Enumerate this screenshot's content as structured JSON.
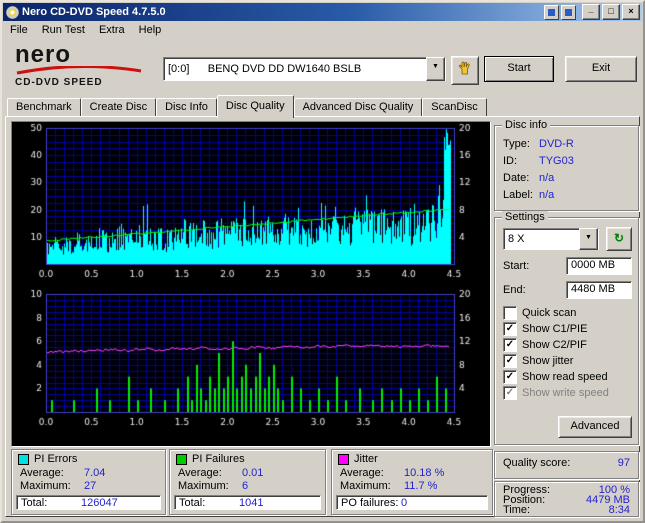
{
  "window": {
    "title": "Nero CD-DVD Speed 4.7.5.0"
  },
  "icons": {
    "minimize": "_",
    "maximize": "□",
    "close": "×",
    "dropdown": "▼",
    "refresh": "↻",
    "check": "✓"
  },
  "menu": {
    "items": [
      {
        "label": "File"
      },
      {
        "label": "Run Test"
      },
      {
        "label": "Extra"
      },
      {
        "label": "Help"
      }
    ]
  },
  "toolbar": {
    "logo_line1": "nero",
    "logo_line2": "CD-DVD SPEED",
    "drive_combo": "[0:0]      BENQ DVD DD DW1640 BSLB",
    "start_label": "Start",
    "exit_label": "Exit"
  },
  "tabs": {
    "items": [
      {
        "label": "Benchmark",
        "active": false
      },
      {
        "label": "Create Disc",
        "active": false
      },
      {
        "label": "Disc Info",
        "active": false
      },
      {
        "label": "Disc Quality",
        "active": true
      },
      {
        "label": "Advanced Disc Quality",
        "active": false
      },
      {
        "label": "ScanDisc",
        "active": false
      }
    ]
  },
  "disc_info": {
    "title": "Disc info",
    "rows": [
      {
        "label": "Type:",
        "value": "DVD-R"
      },
      {
        "label": "ID:",
        "value": "TYG03"
      },
      {
        "label": "Date:",
        "value": "n/a"
      },
      {
        "label": "Label:",
        "value": "n/a"
      }
    ]
  },
  "settings": {
    "title": "Settings",
    "speed_value": "8 X",
    "start_label": "Start:",
    "start_value": "0000 MB",
    "end_label": "End:",
    "end_value": "4480 MB",
    "checkboxes": [
      {
        "label": "Quick scan",
        "checked": false,
        "disabled": false
      },
      {
        "label": "Show C1/PIE",
        "checked": true,
        "disabled": false
      },
      {
        "label": "Show C2/PIF",
        "checked": true,
        "disabled": false
      },
      {
        "label": "Show jitter",
        "checked": true,
        "disabled": false
      },
      {
        "label": "Show read speed",
        "checked": true,
        "disabled": false
      },
      {
        "label": "Show write speed",
        "checked": true,
        "disabled": true
      }
    ],
    "advanced_label": "Advanced"
  },
  "quality": {
    "label": "Quality score:",
    "value": "97"
  },
  "status": {
    "rows": [
      {
        "label": "Progress:",
        "value": "100 %"
      },
      {
        "label": "Position:",
        "value": "4479 MB"
      },
      {
        "label": "Time:",
        "value": "8:34"
      }
    ]
  },
  "panels": [
    {
      "title": "PI Errors",
      "color": "#00e0e0",
      "rows": [
        {
          "label": "Average:",
          "value": "7.04"
        },
        {
          "label": "Maximum:",
          "value": "27"
        }
      ],
      "footer": {
        "label": "Total:",
        "value": "126047"
      }
    },
    {
      "title": "PI Failures",
      "color": "#00cc00",
      "rows": [
        {
          "label": "Average:",
          "value": "0.01"
        },
        {
          "label": "Maximum:",
          "value": "6"
        }
      ],
      "footer": {
        "label": "Total:",
        "value": "1041"
      }
    },
    {
      "title": "Jitter",
      "color": "#ff00ff",
      "rows": [
        {
          "label": "Average:",
          "value": "10.18 %"
        },
        {
          "label": "Maximum:",
          "value": "11.7 %"
        }
      ],
      "footer": {
        "label": "PO failures:",
        "value": "0"
      }
    }
  ],
  "chart_data": [
    {
      "type": "area",
      "title": "PI Errors with read speed overlay",
      "x_ticks": [
        "0.0",
        "0.5",
        "1.0",
        "1.5",
        "2.0",
        "2.5",
        "3.0",
        "3.5",
        "4.0",
        "4.5"
      ],
      "x_max": 4.5,
      "x_step": 0.1,
      "data_x_end": 4.45,
      "y_left": {
        "max": 50,
        "ticks": [
          50,
          40,
          30,
          20,
          10
        ]
      },
      "y_right": {
        "max": 20,
        "ticks": [
          20,
          16,
          12,
          8,
          4
        ]
      },
      "pi_errors": [
        7,
        8,
        6,
        9,
        8,
        9,
        10,
        8,
        11,
        9,
        10,
        12,
        10,
        9,
        11,
        13,
        11,
        12,
        10,
        13,
        12,
        14,
        12,
        11,
        13,
        12,
        14,
        13,
        15,
        13,
        12,
        14,
        15,
        13,
        16,
        14,
        15,
        17,
        15,
        16,
        14,
        15,
        16,
        15,
        46,
        12
      ],
      "end_spike": {
        "x_from": 4.37,
        "x_to": 4.45,
        "value": 46
      },
      "read_speed": {
        "v_start": 3.4,
        "v_end": 8.1,
        "x_end": 4.45,
        "axis": "right"
      },
      "colors": {
        "pi_errors": "#00ffff",
        "read_speed": "#00ff00",
        "grid": "#0000a0",
        "frame": "#4040cc",
        "bg": "#000000",
        "text": "#e8e8e8"
      }
    },
    {
      "type": "line+bars",
      "title": "PI Failures (bars) and Jitter (line)",
      "x_ticks": [
        "0.0",
        "0.5",
        "1.0",
        "1.5",
        "2.0",
        "2.5",
        "3.0",
        "3.5",
        "4.0",
        "4.5"
      ],
      "x_max": 4.5,
      "x_step": 0.1,
      "data_x_end": 4.45,
      "y_left": {
        "max": 10,
        "ticks": [
          10,
          8,
          6,
          4,
          2
        ]
      },
      "y_right": {
        "max": 20,
        "ticks": [
          20,
          16,
          12,
          8,
          4
        ]
      },
      "jitter": [
        5.1,
        5.15,
        5.1,
        5.2,
        5.15,
        5.25,
        5.2,
        5.3,
        5.25,
        5.2,
        5.3,
        5.35,
        5.25,
        5.3,
        5.4,
        5.3,
        5.35,
        5.45,
        5.35,
        5.4,
        5.3,
        5.45,
        5.4,
        5.5,
        5.45,
        5.4,
        5.5,
        5.55,
        5.45,
        5.5,
        5.6,
        5.5,
        5.55,
        5.6,
        5.5,
        5.6,
        5.65,
        5.55,
        5.6,
        5.5,
        5.6,
        5.55,
        5.65,
        5.6,
        5.5,
        5.45
      ],
      "pif_spikes": [
        [
          0.05,
          1
        ],
        [
          0.3,
          1
        ],
        [
          0.55,
          2
        ],
        [
          0.7,
          1
        ],
        [
          0.9,
          3
        ],
        [
          1.0,
          1
        ],
        [
          1.15,
          2
        ],
        [
          1.3,
          1
        ],
        [
          1.45,
          2
        ],
        [
          1.55,
          3
        ],
        [
          1.6,
          1
        ],
        [
          1.65,
          4
        ],
        [
          1.7,
          2
        ],
        [
          1.75,
          1
        ],
        [
          1.8,
          3
        ],
        [
          1.85,
          2
        ],
        [
          1.9,
          5
        ],
        [
          1.95,
          2
        ],
        [
          2.0,
          3
        ],
        [
          2.05,
          6
        ],
        [
          2.1,
          2
        ],
        [
          2.15,
          3
        ],
        [
          2.2,
          4
        ],
        [
          2.25,
          2
        ],
        [
          2.3,
          3
        ],
        [
          2.35,
          5
        ],
        [
          2.4,
          2
        ],
        [
          2.45,
          3
        ],
        [
          2.5,
          4
        ],
        [
          2.55,
          2
        ],
        [
          2.6,
          1
        ],
        [
          2.7,
          3
        ],
        [
          2.8,
          2
        ],
        [
          2.9,
          1
        ],
        [
          3.0,
          2
        ],
        [
          3.1,
          1
        ],
        [
          3.2,
          3
        ],
        [
          3.3,
          1
        ],
        [
          3.45,
          2
        ],
        [
          3.6,
          1
        ],
        [
          3.7,
          2
        ],
        [
          3.8,
          1
        ],
        [
          3.9,
          2
        ],
        [
          4.0,
          1
        ],
        [
          4.1,
          2
        ],
        [
          4.2,
          1
        ],
        [
          4.3,
          3
        ],
        [
          4.4,
          2
        ]
      ],
      "colors": {
        "pif": "#00ee00",
        "jitter": "#ff44ff",
        "grid": "#0000a0",
        "frame": "#4040cc",
        "bg": "#000000",
        "text": "#e8e8e8"
      }
    }
  ]
}
